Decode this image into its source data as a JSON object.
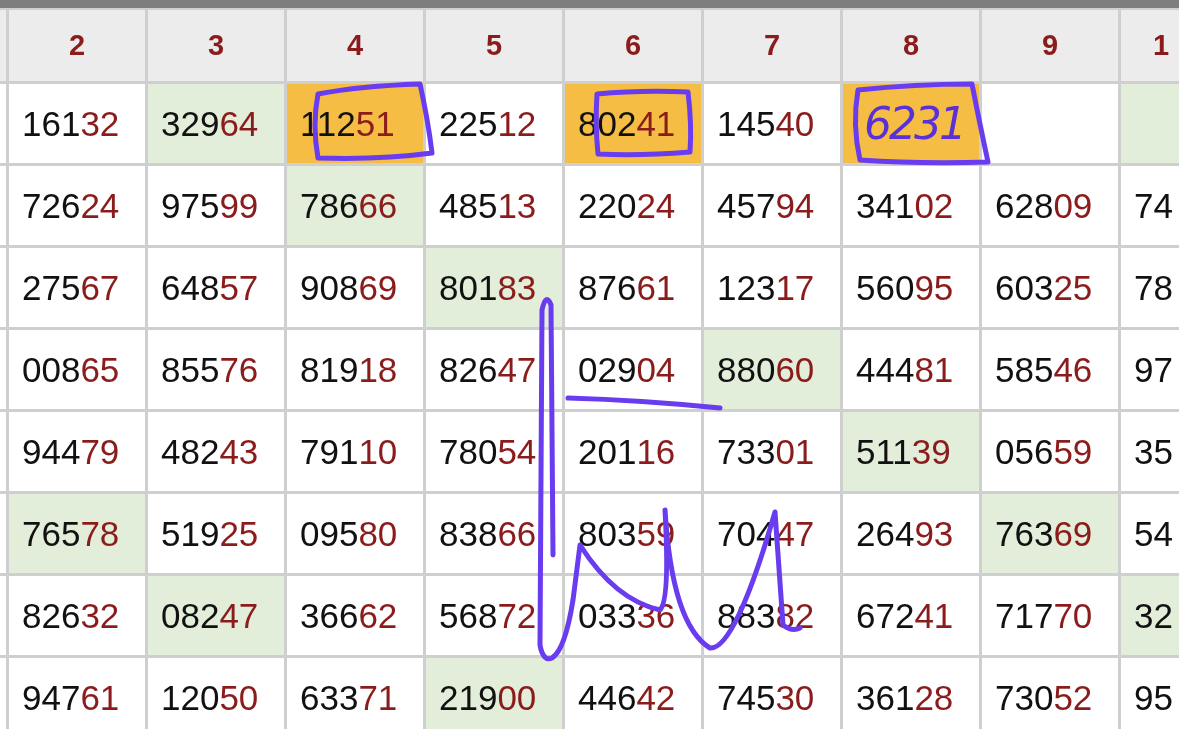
{
  "table": {
    "columns": [
      {
        "label": "2"
      },
      {
        "label": "3"
      },
      {
        "label": "4"
      },
      {
        "label": "5"
      },
      {
        "label": "6"
      },
      {
        "label": "7"
      },
      {
        "label": "8"
      },
      {
        "label": "9"
      },
      {
        "label": "1"
      }
    ],
    "rows": [
      {
        "cells": [
          {
            "head": "161",
            "tail": "32",
            "color": "#ffffff"
          },
          {
            "head": "329",
            "tail": "64",
            "color": "#e2eed9"
          },
          {
            "head": "112",
            "tail": "51",
            "color": "#f6bd45"
          },
          {
            "head": "225",
            "tail": "12",
            "color": "#ffffff"
          },
          {
            "head": "802",
            "tail": "41",
            "color": "#f6bd45"
          },
          {
            "head": "145",
            "tail": "40",
            "color": "#ffffff"
          },
          {
            "note": "6231",
            "color": "#f6bd45"
          },
          {
            "color": "#ffffff"
          },
          {
            "color": "#e2eed9"
          }
        ]
      },
      {
        "cells": [
          {
            "head": "726",
            "tail": "24",
            "color": "#ffffff"
          },
          {
            "head": "975",
            "tail": "99",
            "color": "#ffffff"
          },
          {
            "head": "786",
            "tail": "66",
            "color": "#e2eed9"
          },
          {
            "head": "485",
            "tail": "13",
            "color": "#ffffff"
          },
          {
            "head": "220",
            "tail": "24",
            "color": "#ffffff"
          },
          {
            "head": "457",
            "tail": "94",
            "color": "#ffffff"
          },
          {
            "head": "341",
            "tail": "02",
            "color": "#ffffff"
          },
          {
            "head": "628",
            "tail": "09",
            "color": "#ffffff"
          },
          {
            "head": "74",
            "color": "#ffffff"
          }
        ]
      },
      {
        "cells": [
          {
            "head": "275",
            "tail": "67",
            "color": "#ffffff"
          },
          {
            "head": "648",
            "tail": "57",
            "color": "#ffffff"
          },
          {
            "head": "908",
            "tail": "69",
            "color": "#ffffff"
          },
          {
            "head": "801",
            "tail": "83",
            "color": "#e2eed9"
          },
          {
            "head": "876",
            "tail": "61",
            "color": "#ffffff"
          },
          {
            "head": "123",
            "tail": "17",
            "color": "#ffffff"
          },
          {
            "head": "560",
            "tail": "95",
            "color": "#ffffff"
          },
          {
            "head": "603",
            "tail": "25",
            "color": "#ffffff"
          },
          {
            "head": "78",
            "color": "#ffffff"
          }
        ]
      },
      {
        "cells": [
          {
            "head": "008",
            "tail": "65",
            "color": "#ffffff"
          },
          {
            "head": "855",
            "tail": "76",
            "color": "#ffffff"
          },
          {
            "head": "819",
            "tail": "18",
            "color": "#ffffff"
          },
          {
            "head": "826",
            "tail": "47",
            "color": "#ffffff"
          },
          {
            "head": "029",
            "tail": "04",
            "color": "#ffffff"
          },
          {
            "head": "880",
            "tail": "60",
            "color": "#e2eed9"
          },
          {
            "head": "444",
            "tail": "81",
            "color": "#ffffff"
          },
          {
            "head": "585",
            "tail": "46",
            "color": "#ffffff"
          },
          {
            "head": "97",
            "color": "#ffffff"
          }
        ]
      },
      {
        "cells": [
          {
            "head": "944",
            "tail": "79",
            "color": "#ffffff"
          },
          {
            "head": "482",
            "tail": "43",
            "color": "#ffffff"
          },
          {
            "head": "791",
            "tail": "10",
            "color": "#ffffff"
          },
          {
            "head": "780",
            "tail": "54",
            "color": "#ffffff"
          },
          {
            "head": "201",
            "tail": "16",
            "color": "#ffffff"
          },
          {
            "head": "733",
            "tail": "01",
            "color": "#ffffff"
          },
          {
            "head": "511",
            "tail": "39",
            "color": "#e2eed9"
          },
          {
            "head": "056",
            "tail": "59",
            "color": "#ffffff"
          },
          {
            "head": "35",
            "color": "#ffffff"
          }
        ]
      },
      {
        "cells": [
          {
            "head": "765",
            "tail": "78",
            "color": "#e2eed9"
          },
          {
            "head": "519",
            "tail": "25",
            "color": "#ffffff"
          },
          {
            "head": "095",
            "tail": "80",
            "color": "#ffffff"
          },
          {
            "head": "838",
            "tail": "66",
            "color": "#ffffff"
          },
          {
            "head": "803",
            "tail": "59",
            "color": "#ffffff"
          },
          {
            "head": "704",
            "tail": "47",
            "color": "#ffffff"
          },
          {
            "head": "264",
            "tail": "93",
            "color": "#ffffff"
          },
          {
            "head": "763",
            "tail": "69",
            "color": "#e2eed9"
          },
          {
            "head": "54",
            "color": "#ffffff"
          }
        ]
      },
      {
        "cells": [
          {
            "head": "826",
            "tail": "32",
            "color": "#ffffff"
          },
          {
            "head": "082",
            "tail": "47",
            "color": "#e2eed9"
          },
          {
            "head": "366",
            "tail": "62",
            "color": "#ffffff"
          },
          {
            "head": "568",
            "tail": "72",
            "color": "#ffffff"
          },
          {
            "head": "033",
            "tail": "36",
            "color": "#ffffff"
          },
          {
            "head": "883",
            "tail": "82",
            "color": "#ffffff"
          },
          {
            "head": "672",
            "tail": "41",
            "color": "#ffffff"
          },
          {
            "head": "717",
            "tail": "70",
            "color": "#ffffff"
          },
          {
            "head": "32",
            "color": "#e2eed9"
          }
        ]
      },
      {
        "cells": [
          {
            "head": "947",
            "tail": "61",
            "color": "#ffffff"
          },
          {
            "head": "120",
            "tail": "50",
            "color": "#ffffff"
          },
          {
            "head": "633",
            "tail": "71",
            "color": "#ffffff"
          },
          {
            "head": "219",
            "tail": "00",
            "color": "#e2eed9"
          },
          {
            "head": "446",
            "tail": "42",
            "color": "#ffffff"
          },
          {
            "head": "745",
            "tail": "30",
            "color": "#ffffff"
          },
          {
            "head": "361",
            "tail": "28",
            "color": "#ffffff"
          },
          {
            "head": "730",
            "tail": "52",
            "color": "#ffffff"
          },
          {
            "head": "95",
            "color": "#ffffff"
          }
        ]
      }
    ]
  }
}
